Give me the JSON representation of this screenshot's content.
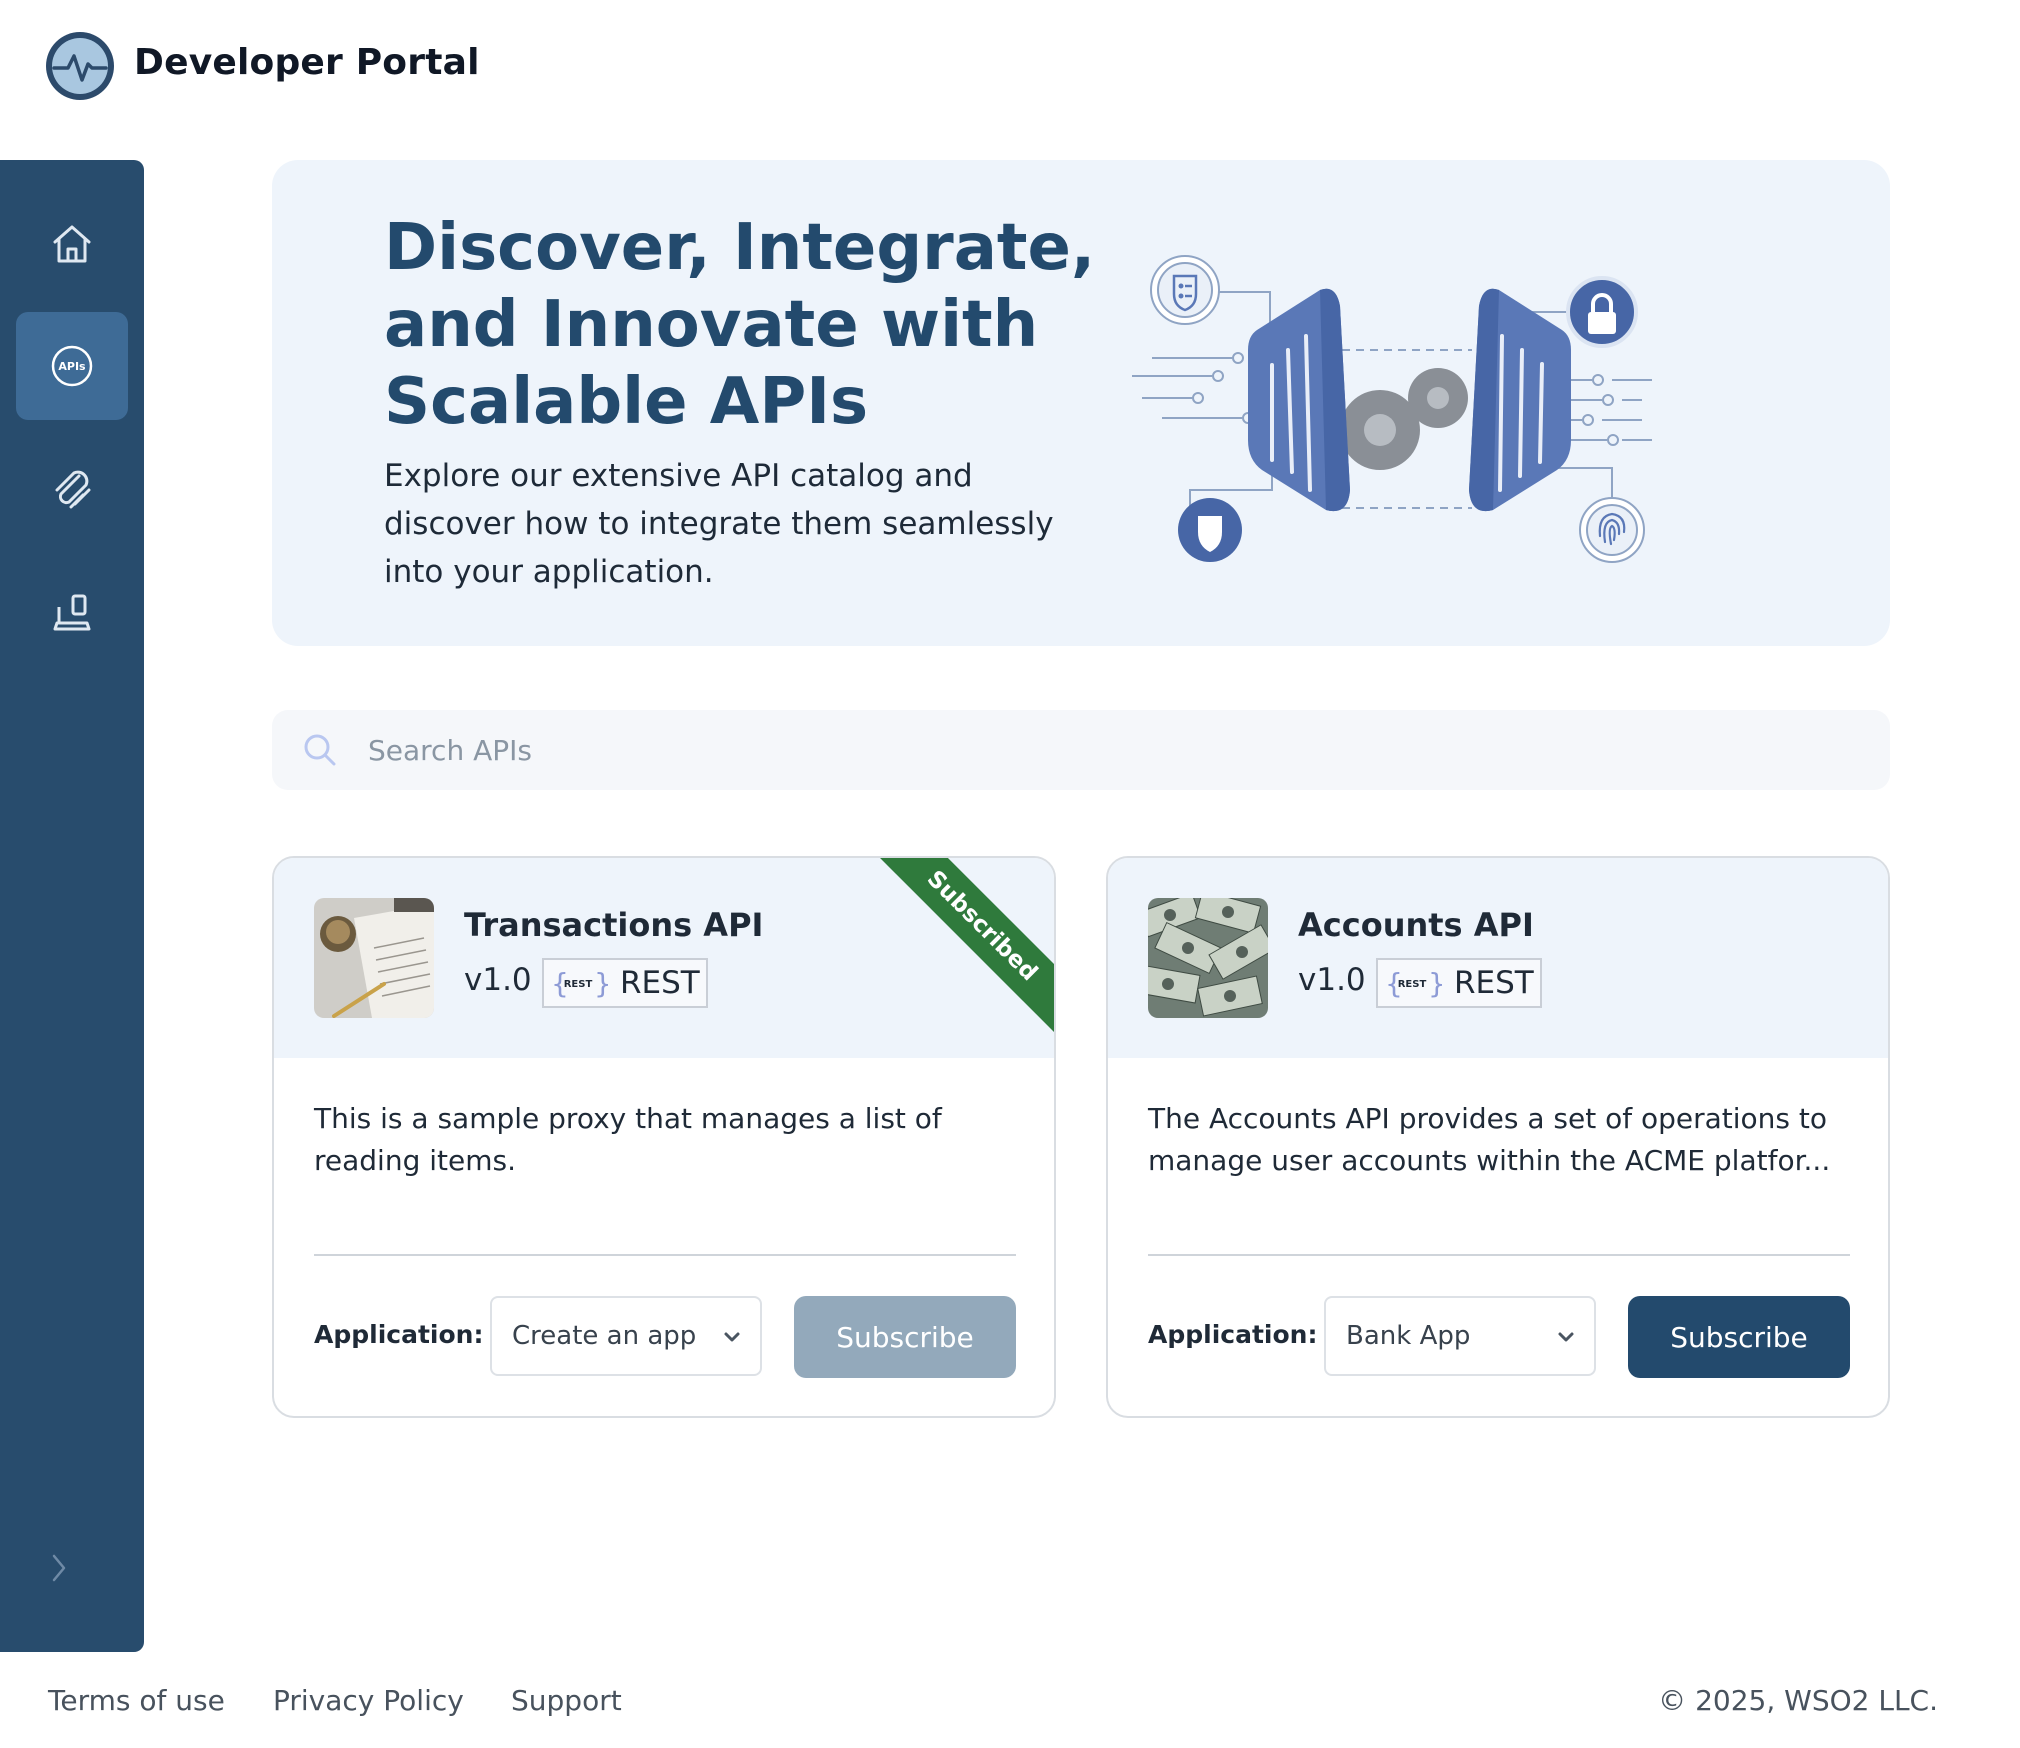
{
  "header": {
    "brand": "Developer Portal"
  },
  "sidebar": {
    "items": [
      {
        "name": "home",
        "icon": "home-icon",
        "active": false
      },
      {
        "name": "apis",
        "icon": "apis-icon",
        "label": "APIs",
        "active": true
      },
      {
        "name": "paperclip",
        "icon": "paperclip-icon",
        "active": false
      },
      {
        "name": "applications",
        "icon": "laptop-icon",
        "active": false
      }
    ],
    "collapse_icon": "chevron-right-icon"
  },
  "hero": {
    "title": "Discover, Integrate, and Innovate with Scalable APIs",
    "description": "Explore our extensive API catalog and discover how to integrate them seamlessly into your application."
  },
  "search": {
    "placeholder": "Search APIs"
  },
  "cards": [
    {
      "name": "Transactions API",
      "version": "v1.0",
      "type_logo": "REST",
      "type": "REST",
      "ribbon": "Subscribed",
      "description": "This is a sample proxy that manages a list of reading items.",
      "application_label": "Application:",
      "selected_application": "Create an app",
      "subscribe_label": "Subscribe",
      "subscribe_enabled": false
    },
    {
      "name": "Accounts API",
      "version": "v1.0",
      "type_logo": "REST",
      "type": "REST",
      "description": "The Accounts API provides a set of operations to manage user accounts within the ACME platfor...",
      "application_label": "Application:",
      "selected_application": "Bank App",
      "subscribe_label": "Subscribe",
      "subscribe_enabled": true
    }
  ],
  "footer": {
    "links": [
      "Terms of use",
      "Privacy Policy",
      "Support"
    ],
    "copyright": "© 2025, WSO2 LLC."
  },
  "colors": {
    "sidebar": "#284c6d",
    "sidebar_active": "#3e6b96",
    "primary": "#234a6d",
    "hero_bg": "#eef4fb",
    "ribbon": "#2f7a3c",
    "button_disabled": "#93a9bb"
  }
}
